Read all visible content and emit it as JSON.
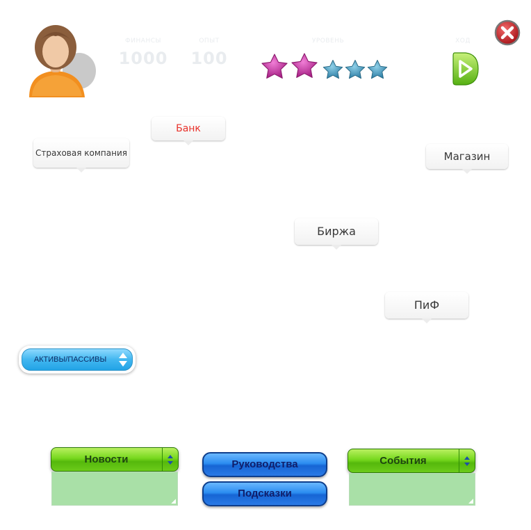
{
  "stats": [
    {
      "caption": "ФИНАНСЫ",
      "value": "1000"
    },
    {
      "caption": "ОПЫТ",
      "value": "100"
    }
  ],
  "rating": {
    "caption": "УРОВЕНЬ",
    "filled": 2,
    "total": 5
  },
  "next": {
    "caption": "ХОД",
    "icon": "next-arrow-icon"
  },
  "close": {
    "icon": "close-icon"
  },
  "places": {
    "bank": "Банк",
    "insurance": "Страховая компания",
    "shop": "Магазин",
    "exchange": "Биржа",
    "fund": "ПиФ"
  },
  "assets_toggle": "АКТИВЫ/ПАССИВЫ",
  "bottom": {
    "news": "Новости",
    "guides": "Руководства",
    "hints": "Подсказки",
    "events": "События"
  },
  "colors": {
    "bank_label": "#e8312a",
    "star_pink": "#c0309a",
    "star_blue": "#3c8fb4",
    "green_button": "#66c914",
    "blue_button": "#2a7ae6",
    "panel": "#a9e0a7"
  }
}
